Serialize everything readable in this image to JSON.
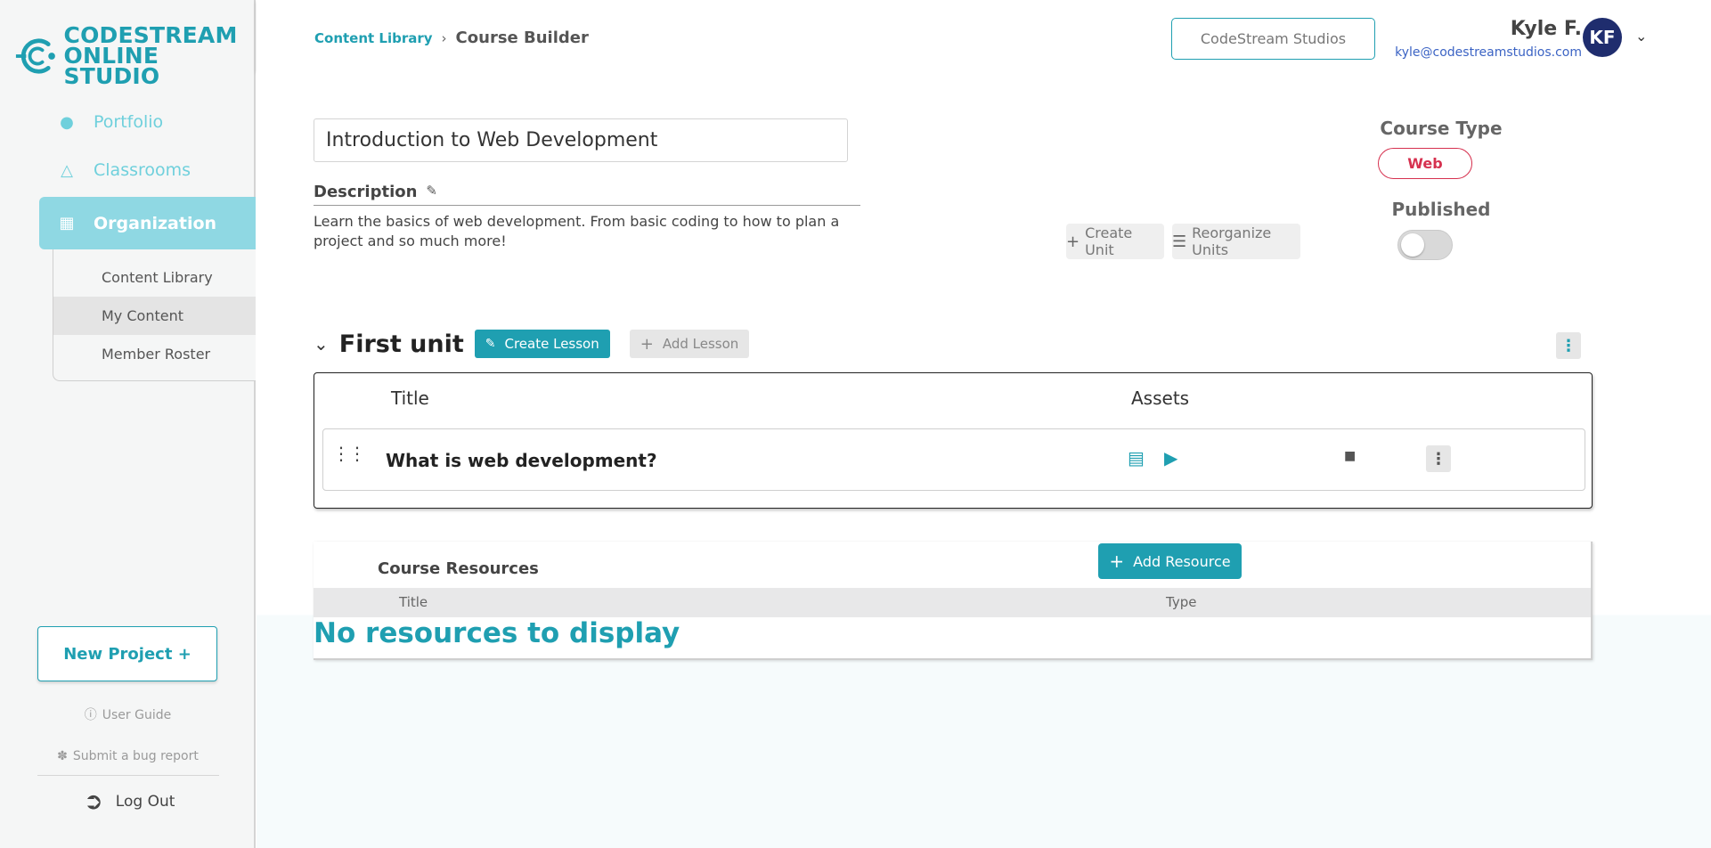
{
  "brand": {
    "line1": "CODESTREAM",
    "line2": "ONLINE STUDIO",
    "color": "#1f9fb1"
  },
  "sidebar": {
    "items": [
      {
        "label": "Portfolio",
        "icon": "person-icon"
      },
      {
        "label": "Classrooms",
        "icon": "graduation-cap-icon"
      },
      {
        "label": "Organization",
        "icon": "organization-icon"
      }
    ],
    "subitems": [
      {
        "label": "Content Library"
      },
      {
        "label": "My Content"
      },
      {
        "label": "Member Roster"
      }
    ],
    "new_project": "New Project +",
    "user_guide": "User Guide",
    "bug_report": "Submit a bug report",
    "logout": "Log Out"
  },
  "header": {
    "breadcrumb_link": "Content Library",
    "breadcrumb_current": "Course Builder",
    "org_button": "CodeStream Studios",
    "user_name": "Kyle F.",
    "user_email": "kyle@codestreamstudios.com",
    "avatar_initials": "KF"
  },
  "course": {
    "title": "Introduction to Web Development",
    "description_label": "Description",
    "description": "Learn the basics of web development. From basic coding to how to plan a project and so much more!",
    "type_label": "Course Type",
    "type_value": "Web",
    "published_label": "Published",
    "published": false,
    "create_unit": "Create Unit",
    "reorganize_units": "Reorganize Units"
  },
  "unit": {
    "title": "First unit",
    "create_lesson": "Create Lesson",
    "add_lesson": "Add Lesson",
    "col_title": "Title",
    "col_assets": "Assets",
    "lessons": [
      {
        "title": "What is web development?"
      }
    ]
  },
  "resources": {
    "label": "Course Resources",
    "add_button": "Add Resource",
    "col_title": "Title",
    "col_type": "Type",
    "empty": "No resources to display"
  }
}
